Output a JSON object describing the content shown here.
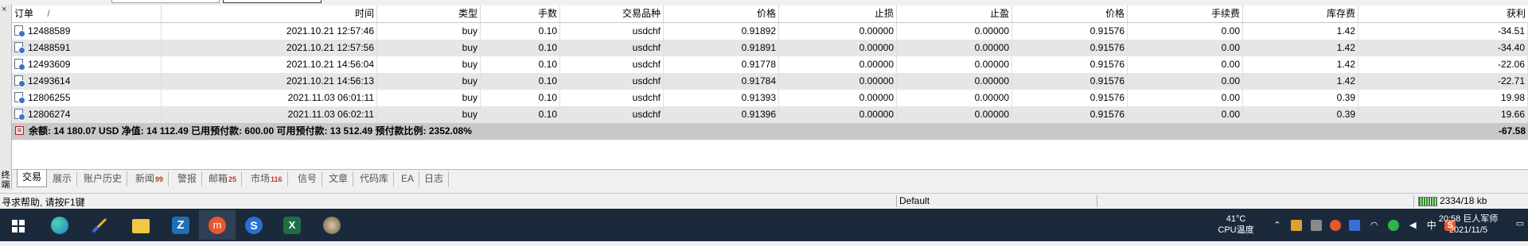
{
  "table": {
    "headers": [
      "订单",
      "时间",
      "类型",
      "手数",
      "交易品种",
      "价格",
      "止损",
      "止盈",
      "价格",
      "手续费",
      "库存费",
      "获利"
    ],
    "sort_indicator": "/",
    "rows": [
      {
        "order": "12488589",
        "time": "2021.10.21 12:57:46",
        "type": "buy",
        "volume": "0.10",
        "symbol": "usdchf",
        "price": "0.91892",
        "sl": "0.00000",
        "tp": "0.00000",
        "current": "0.91576",
        "commission": "0.00",
        "swap": "1.42",
        "profit": "-34.51"
      },
      {
        "order": "12488591",
        "time": "2021.10.21 12:57:56",
        "type": "buy",
        "volume": "0.10",
        "symbol": "usdchf",
        "price": "0.91891",
        "sl": "0.00000",
        "tp": "0.00000",
        "current": "0.91576",
        "commission": "0.00",
        "swap": "1.42",
        "profit": "-34.40"
      },
      {
        "order": "12493609",
        "time": "2021.10.21 14:56:04",
        "type": "buy",
        "volume": "0.10",
        "symbol": "usdchf",
        "price": "0.91778",
        "sl": "0.00000",
        "tp": "0.00000",
        "current": "0.91576",
        "commission": "0.00",
        "swap": "1.42",
        "profit": "-22.06"
      },
      {
        "order": "12493614",
        "time": "2021.10.21 14:56:13",
        "type": "buy",
        "volume": "0.10",
        "symbol": "usdchf",
        "price": "0.91784",
        "sl": "0.00000",
        "tp": "0.00000",
        "current": "0.91576",
        "commission": "0.00",
        "swap": "1.42",
        "profit": "-22.71"
      },
      {
        "order": "12806255",
        "time": "2021.11.03 06:01:11",
        "type": "buy",
        "volume": "0.10",
        "symbol": "usdchf",
        "price": "0.91393",
        "sl": "0.00000",
        "tp": "0.00000",
        "current": "0.91576",
        "commission": "0.00",
        "swap": "0.39",
        "profit": "19.98"
      },
      {
        "order": "12806274",
        "time": "2021.11.03 06:02:11",
        "type": "buy",
        "volume": "0.10",
        "symbol": "usdchf",
        "price": "0.91396",
        "sl": "0.00000",
        "tp": "0.00000",
        "current": "0.91576",
        "commission": "0.00",
        "swap": "0.39",
        "profit": "19.66"
      }
    ],
    "summary": {
      "text": "余额: 14 180.07 USD  净值: 14 112.49  已用预付款: 600.00  可用预付款: 13 512.49  预付款比例: 2352.08%",
      "profit": "-67.58"
    }
  },
  "sidebar": {
    "label": "终端"
  },
  "tabs": [
    {
      "label": "交易",
      "badge": "",
      "active": true
    },
    {
      "label": "展示",
      "badge": ""
    },
    {
      "label": "账户历史",
      "badge": ""
    },
    {
      "label": "新闻",
      "badge": "99"
    },
    {
      "label": "警报",
      "badge": ""
    },
    {
      "label": "邮箱",
      "badge": "25"
    },
    {
      "label": "市场",
      "badge": "116"
    },
    {
      "label": "信号",
      "badge": ""
    },
    {
      "label": "文章",
      "badge": ""
    },
    {
      "label": "代码库",
      "badge": ""
    },
    {
      "label": "EA",
      "badge": ""
    },
    {
      "label": "日志",
      "badge": ""
    }
  ],
  "status": {
    "help": "寻求帮助, 请按F1键",
    "profile": "Default",
    "connection": "2334/18 kb"
  },
  "taskbar": {
    "apps": [
      "start-icon",
      "edge-icon",
      "trading-app-icon",
      "file-explorer-icon",
      "zotero-icon",
      "app-orange-icon",
      "sogou-icon",
      "excel-icon",
      "avatar-app-icon"
    ],
    "weather_temp": "41°C",
    "weather_label": "CPU温度",
    "ime": "中",
    "time": "2021/11/5",
    "clock_overlay": "20:58 巨人军师"
  },
  "colors": {
    "taskbar": "#1b2a3b",
    "summary": "#c8c8c8",
    "badge": "#c0392b"
  }
}
